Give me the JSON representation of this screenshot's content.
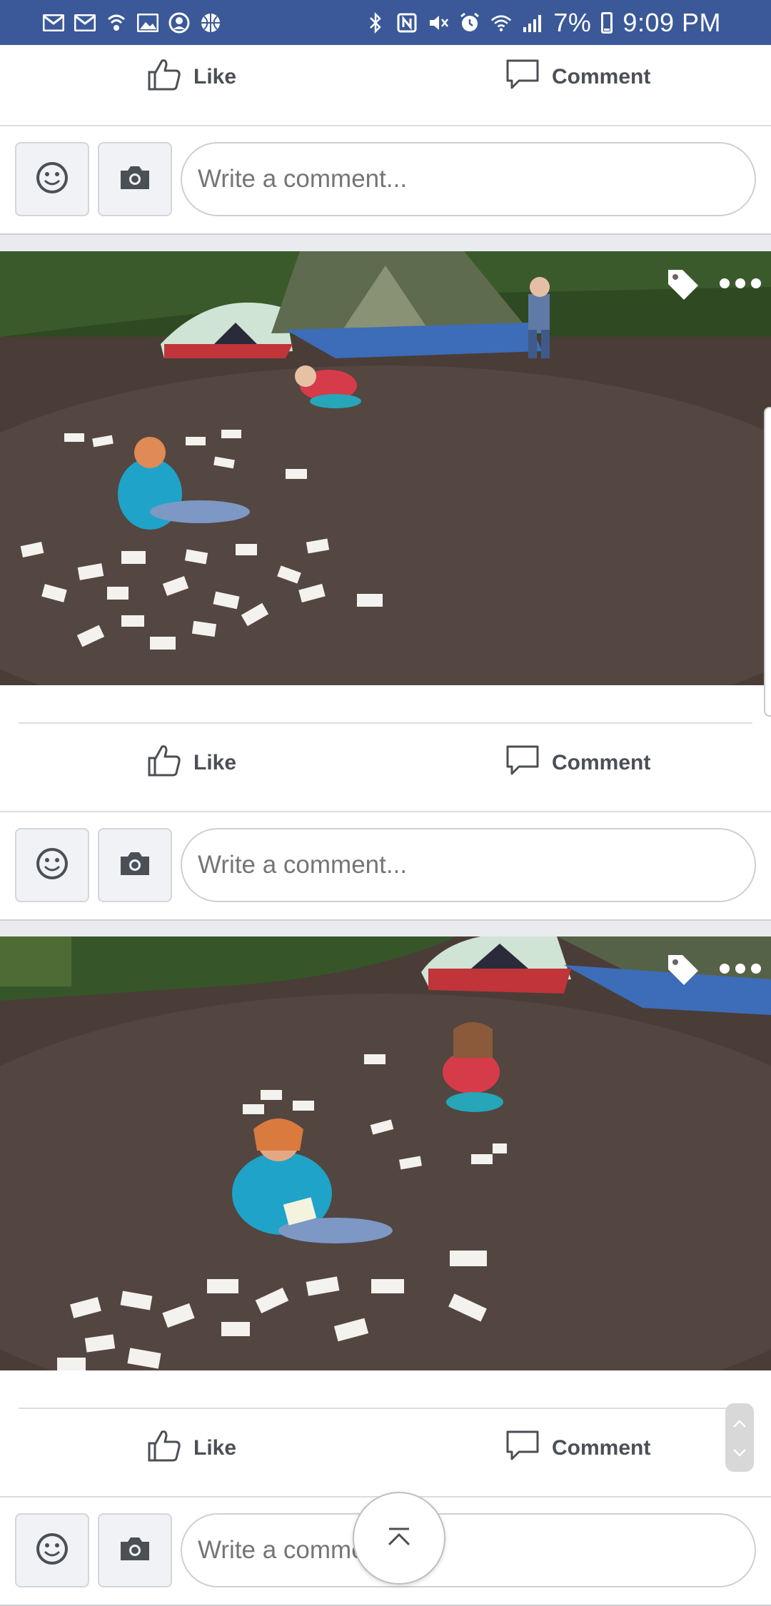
{
  "status_bar": {
    "left_icons": [
      "gmail-icon",
      "gmail-icon",
      "wifi-calling-icon",
      "image-icon",
      "account-icon",
      "basketball-icon"
    ],
    "right_icons": [
      "bluetooth-icon",
      "nfc-icon",
      "mute-icon",
      "alarm-icon",
      "wifi-icon",
      "signal-icon"
    ],
    "battery": "7%",
    "time": "9:09 PM"
  },
  "actions": {
    "like_label": "Like",
    "comment_label": "Comment"
  },
  "composer": {
    "placeholder": "Write a comment..."
  },
  "posts": [
    {
      "photo_alt": "Children playing with white cards on dirt near tents at a campsite"
    },
    {
      "photo_alt": "Two girls crouched among scattered white cards near tents"
    }
  ],
  "colors": {
    "brand": "#3b5998",
    "action_text": "#4b4f56",
    "placeholder": "#6a6f76"
  }
}
